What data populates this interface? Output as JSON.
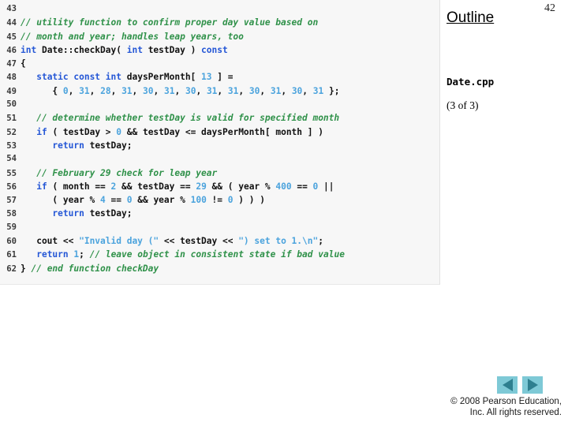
{
  "slide": {
    "page_number": "42",
    "background_color": "#ffffff"
  },
  "outline": {
    "title": "Outline",
    "file_name": "Date.cpp",
    "progress": "(3 of 3)"
  },
  "code_panel": {
    "background_color": "#f7f7f7",
    "colors": {
      "comment": "#2f9149",
      "keyword": "#2557d6",
      "number": "#4ba3dd",
      "string": "#4ba3dd",
      "identifier": "#111111",
      "line_number": "#3a3a3a"
    },
    "lines": [
      {
        "number": "43",
        "tokens": []
      },
      {
        "number": "44",
        "tokens": [
          {
            "t": "// utility function to confirm proper day value based on",
            "c": "t-com"
          }
        ]
      },
      {
        "number": "45",
        "tokens": [
          {
            "t": "// month and year; handles leap years, too",
            "c": "t-com"
          }
        ]
      },
      {
        "number": "46",
        "tokens": [
          {
            "t": "int",
            "c": "t-kw"
          },
          {
            "t": " Date::checkDay( ",
            "c": "t-pln"
          },
          {
            "t": "int",
            "c": "t-kw"
          },
          {
            "t": " testDay ) ",
            "c": "t-pln"
          },
          {
            "t": "const",
            "c": "t-kw"
          }
        ]
      },
      {
        "number": "47",
        "tokens": [
          {
            "t": "{",
            "c": "t-pln"
          }
        ]
      },
      {
        "number": "48",
        "tokens": [
          {
            "t": "   ",
            "c": "t-pln"
          },
          {
            "t": "static const int",
            "c": "t-kw"
          },
          {
            "t": " daysPerMonth[ ",
            "c": "t-pln"
          },
          {
            "t": "13",
            "c": "t-num"
          },
          {
            "t": " ] =",
            "c": "t-pln"
          }
        ]
      },
      {
        "number": "49",
        "tokens": [
          {
            "t": "      { ",
            "c": "t-pln"
          },
          {
            "t": "0",
            "c": "t-num"
          },
          {
            "t": ", ",
            "c": "t-pln"
          },
          {
            "t": "31",
            "c": "t-num"
          },
          {
            "t": ", ",
            "c": "t-pln"
          },
          {
            "t": "28",
            "c": "t-num"
          },
          {
            "t": ", ",
            "c": "t-pln"
          },
          {
            "t": "31",
            "c": "t-num"
          },
          {
            "t": ", ",
            "c": "t-pln"
          },
          {
            "t": "30",
            "c": "t-num"
          },
          {
            "t": ", ",
            "c": "t-pln"
          },
          {
            "t": "31",
            "c": "t-num"
          },
          {
            "t": ", ",
            "c": "t-pln"
          },
          {
            "t": "30",
            "c": "t-num"
          },
          {
            "t": ", ",
            "c": "t-pln"
          },
          {
            "t": "31",
            "c": "t-num"
          },
          {
            "t": ", ",
            "c": "t-pln"
          },
          {
            "t": "31",
            "c": "t-num"
          },
          {
            "t": ", ",
            "c": "t-pln"
          },
          {
            "t": "30",
            "c": "t-num"
          },
          {
            "t": ", ",
            "c": "t-pln"
          },
          {
            "t": "31",
            "c": "t-num"
          },
          {
            "t": ", ",
            "c": "t-pln"
          },
          {
            "t": "30",
            "c": "t-num"
          },
          {
            "t": ", ",
            "c": "t-pln"
          },
          {
            "t": "31",
            "c": "t-num"
          },
          {
            "t": " };",
            "c": "t-pln"
          }
        ]
      },
      {
        "number": "50",
        "tokens": []
      },
      {
        "number": "51",
        "tokens": [
          {
            "t": "   ",
            "c": "t-pln"
          },
          {
            "t": "// determine whether testDay is valid for specified month",
            "c": "t-com"
          }
        ]
      },
      {
        "number": "52",
        "tokens": [
          {
            "t": "   ",
            "c": "t-pln"
          },
          {
            "t": "if",
            "c": "t-kw"
          },
          {
            "t": " ( testDay > ",
            "c": "t-pln"
          },
          {
            "t": "0",
            "c": "t-num"
          },
          {
            "t": " && testDay <= daysPerMonth[ month ] )",
            "c": "t-pln"
          }
        ]
      },
      {
        "number": "53",
        "tokens": [
          {
            "t": "      ",
            "c": "t-pln"
          },
          {
            "t": "return",
            "c": "t-kw"
          },
          {
            "t": " testDay;",
            "c": "t-pln"
          }
        ]
      },
      {
        "number": "54",
        "tokens": []
      },
      {
        "number": "55",
        "tokens": [
          {
            "t": "   ",
            "c": "t-pln"
          },
          {
            "t": "// February 29 check for leap year",
            "c": "t-com"
          }
        ]
      },
      {
        "number": "56",
        "tokens": [
          {
            "t": "   ",
            "c": "t-pln"
          },
          {
            "t": "if",
            "c": "t-kw"
          },
          {
            "t": " ( month == ",
            "c": "t-pln"
          },
          {
            "t": "2",
            "c": "t-num"
          },
          {
            "t": " && testDay == ",
            "c": "t-pln"
          },
          {
            "t": "29",
            "c": "t-num"
          },
          {
            "t": " && ( year % ",
            "c": "t-pln"
          },
          {
            "t": "400",
            "c": "t-num"
          },
          {
            "t": " == ",
            "c": "t-pln"
          },
          {
            "t": "0",
            "c": "t-num"
          },
          {
            "t": " ||",
            "c": "t-pln"
          }
        ]
      },
      {
        "number": "57",
        "tokens": [
          {
            "t": "      ( year % ",
            "c": "t-pln"
          },
          {
            "t": "4",
            "c": "t-num"
          },
          {
            "t": " == ",
            "c": "t-pln"
          },
          {
            "t": "0",
            "c": "t-num"
          },
          {
            "t": " && year % ",
            "c": "t-pln"
          },
          {
            "t": "100",
            "c": "t-num"
          },
          {
            "t": " != ",
            "c": "t-pln"
          },
          {
            "t": "0",
            "c": "t-num"
          },
          {
            "t": " ) ) )",
            "c": "t-pln"
          }
        ]
      },
      {
        "number": "58",
        "tokens": [
          {
            "t": "      ",
            "c": "t-pln"
          },
          {
            "t": "return",
            "c": "t-kw"
          },
          {
            "t": " testDay;",
            "c": "t-pln"
          }
        ]
      },
      {
        "number": "59",
        "tokens": []
      },
      {
        "number": "60",
        "tokens": [
          {
            "t": "   cout << ",
            "c": "t-pln"
          },
          {
            "t": "\"Invalid day (\"",
            "c": "t-str"
          },
          {
            "t": " << testDay << ",
            "c": "t-pln"
          },
          {
            "t": "\") set to 1.\\n\"",
            "c": "t-str"
          },
          {
            "t": ";",
            "c": "t-pln"
          }
        ]
      },
      {
        "number": "61",
        "tokens": [
          {
            "t": "   ",
            "c": "t-pln"
          },
          {
            "t": "return",
            "c": "t-kw"
          },
          {
            "t": " ",
            "c": "t-pln"
          },
          {
            "t": "1",
            "c": "t-num"
          },
          {
            "t": "; ",
            "c": "t-pln"
          },
          {
            "t": "// leave object in consistent state if bad value",
            "c": "t-com"
          }
        ]
      },
      {
        "number": "62",
        "tokens": [
          {
            "t": "} ",
            "c": "t-pln"
          },
          {
            "t": "// end function checkDay",
            "c": "t-com"
          }
        ]
      }
    ]
  },
  "navigation": {
    "previous_label": "previous-slide",
    "next_label": "next-slide",
    "button_color": "#7ec9d6",
    "arrow_color": "#2e7f8f"
  },
  "footer": {
    "copyright_line1": "© 2008 Pearson Education,",
    "copyright_line2": "Inc.  All rights reserved."
  }
}
